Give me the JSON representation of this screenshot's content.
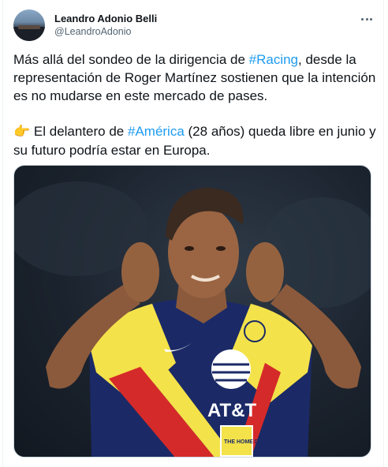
{
  "author": {
    "display_name": "Leandro Adonio Belli",
    "handle": "@LeandroAdonio"
  },
  "more_icon": "more-horizontal-icon",
  "tweet": {
    "p1_before": "Más allá del sondeo de la dirigencia de ",
    "p1_hashtag": "#Racing",
    "p1_after": ", desde la representación de Roger Martínez sostienen que la intención es no mudarse en este mercado de pases.",
    "p2_emoji": "👉",
    "p2_before": " El delantero de ",
    "p2_hashtag": "#América",
    "p2_after": " (28 años) queda libre en junio y su futuro podría estar en Europa."
  },
  "media": {
    "jersey_sponsor": "AT&T",
    "jersey_sponsor_2": "THE HOME DEPOT"
  },
  "colors": {
    "link": "#1d9bf0",
    "jersey_yellow": "#f4e24a",
    "jersey_navy": "#1b2a66",
    "jersey_red": "#d52a2a"
  }
}
